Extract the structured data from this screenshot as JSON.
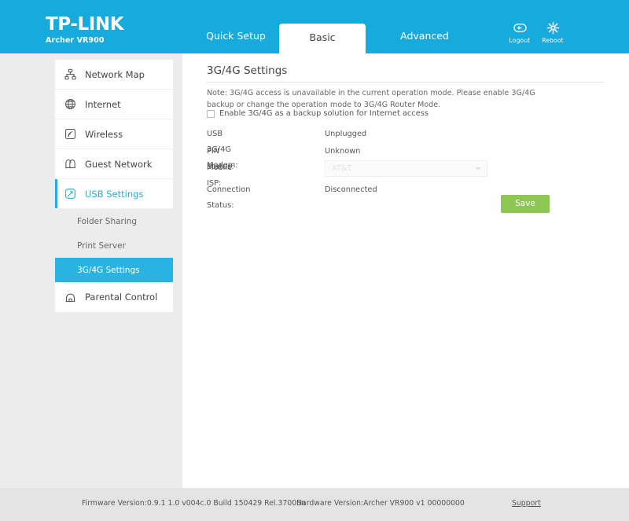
{
  "header": {
    "logo_main": "TP-LINK",
    "logo_sub": "Archer VR900",
    "tabs": [
      {
        "label": "Quick Setup",
        "active": false
      },
      {
        "label": "Basic",
        "active": true
      },
      {
        "label": "Advanced",
        "active": false
      }
    ],
    "icons": [
      {
        "name": "logout-icon",
        "label": "Logout"
      },
      {
        "name": "reboot-icon",
        "label": "Reboot"
      }
    ],
    "background_color": "#16aadd"
  },
  "sidebar": {
    "items": [
      {
        "label": "Network Map",
        "icon": "network-map-icon",
        "active": false
      },
      {
        "label": "Internet",
        "icon": "globe-icon",
        "active": false
      },
      {
        "label": "Wireless",
        "icon": "wireless-icon",
        "active": false
      },
      {
        "label": "Guest Network",
        "icon": "guest-network-icon",
        "active": false
      },
      {
        "label": "USB Settings",
        "icon": "usb-icon",
        "active": true
      }
    ],
    "subitems": [
      {
        "label": "Folder Sharing",
        "active": false
      },
      {
        "label": "Print Server",
        "active": false
      },
      {
        "label": "3G/4G Settings",
        "active": true
      }
    ],
    "parental": {
      "label": "Parental Control",
      "icon": "parental-control-icon",
      "active": false
    },
    "active_color": "#29b3e3"
  },
  "main": {
    "title": "3G/4G Settings",
    "note": "Note: 3G/4G access is unavailable in the current operation mode. Please enable 3G/4G backup or change the operation mode to 3G/4G Router Mode.",
    "checkbox": {
      "label": "Enable 3G/4G as a backup solution for Internet access",
      "checked": false
    },
    "fields": [
      {
        "label": "USB 3G/4G Modem:",
        "value": "Unplugged"
      },
      {
        "label": "PIN Status:",
        "value": "Unknown"
      },
      {
        "label": "Mobile ISP:",
        "value": "AT&T",
        "type": "select",
        "disabled": true
      },
      {
        "label": "Connection Status:",
        "value": "Disconnected"
      }
    ],
    "save_label": "Save",
    "save_color": "#8dc653"
  },
  "footer": {
    "firmware": "Firmware Version:0.9.1 1.0 v004c.0 Build 150429 Rel.37005n",
    "hardware": "Hardware Version:Archer VR900 v1 00000000",
    "support": "Support"
  }
}
